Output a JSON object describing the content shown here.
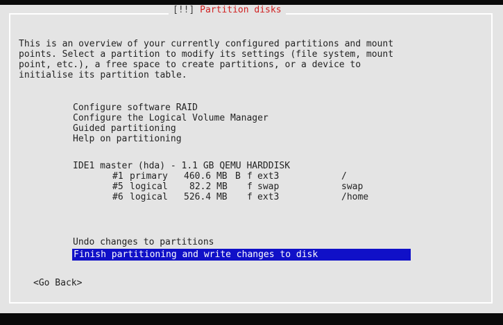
{
  "dialog": {
    "title_left": "[!!]",
    "title": "Partition disks",
    "intro_lines": [
      "This is an overview of your currently configured partitions and mount",
      "points. Select a partition to modify its settings (file system, mount",
      "point, etc.), a free space to create partitions, or a device to",
      "initialise its partition table."
    ]
  },
  "menu": {
    "configure_raid": "Configure software RAID",
    "configure_lvm": "Configure the Logical Volume Manager",
    "guided": "Guided partitioning",
    "help": "Help on partitioning",
    "disk": "IDE1 master (hda) - 1.1 GB QEMU HARDDISK",
    "partitions": [
      {
        "number": "#1",
        "type": "primary",
        "size": "460.6 MB",
        "flag": "B",
        "format": "f",
        "fs": "ext3",
        "mount": "/"
      },
      {
        "number": "#5",
        "type": "logical",
        "size": "82.2 MB",
        "flag": "",
        "format": "f",
        "fs": "swap",
        "mount": "swap"
      },
      {
        "number": "#6",
        "type": "logical",
        "size": "526.4 MB",
        "flag": "",
        "format": "f",
        "fs": "ext3",
        "mount": "/home"
      }
    ],
    "undo": "Undo changes to partitions",
    "finish": "Finish partitioning and write changes to disk"
  },
  "buttons": {
    "go_back": "<Go Back>"
  }
}
